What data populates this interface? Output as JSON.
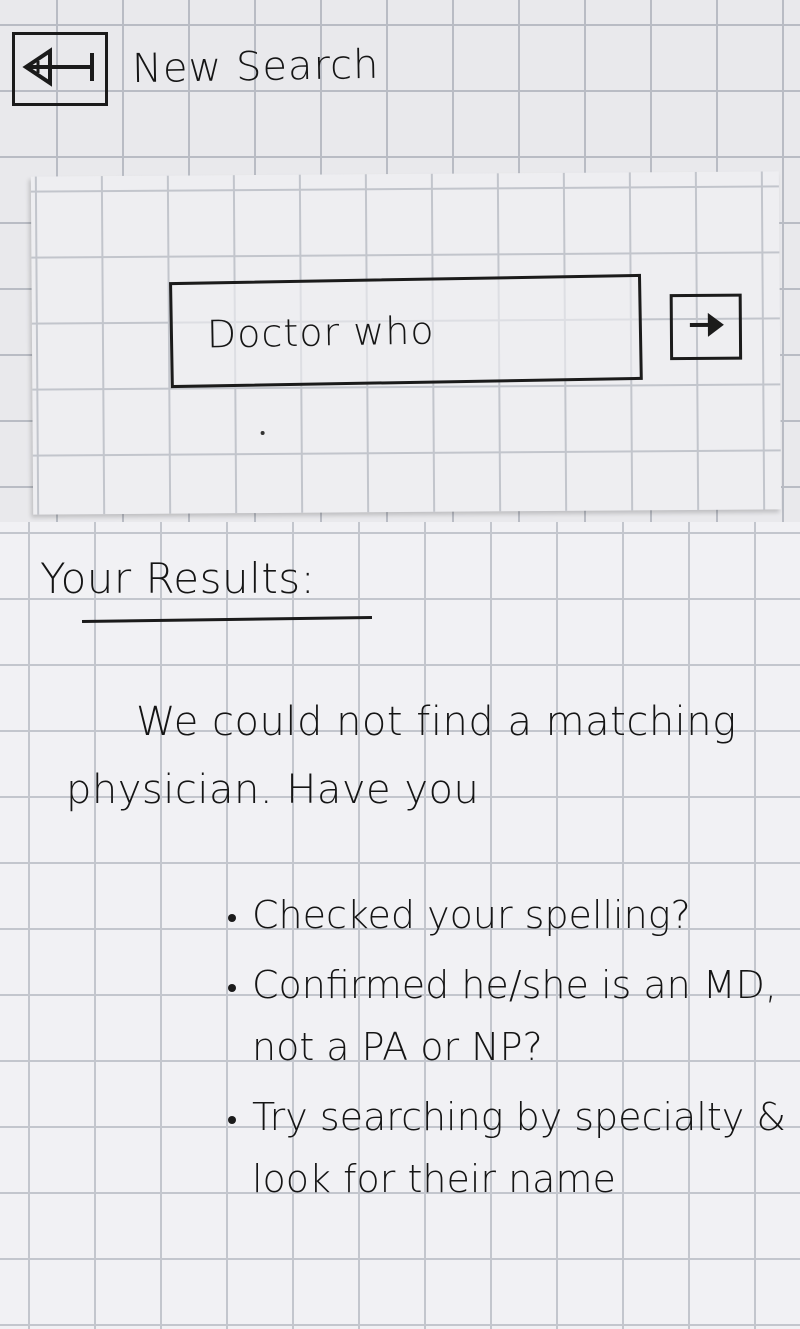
{
  "header": {
    "title": "New Search",
    "back_icon": "back-arrow-icon"
  },
  "search": {
    "value": "Doctor who",
    "submit_icon": "arrow-right-icon"
  },
  "results": {
    "heading": "Your Results:",
    "message": "We could not find a matching physician. Have you",
    "tips": [
      "Checked your spelling?",
      "Confirmed he/she is an MD, not a PA or NP?",
      "Try searching by specialty & look for their name"
    ]
  }
}
